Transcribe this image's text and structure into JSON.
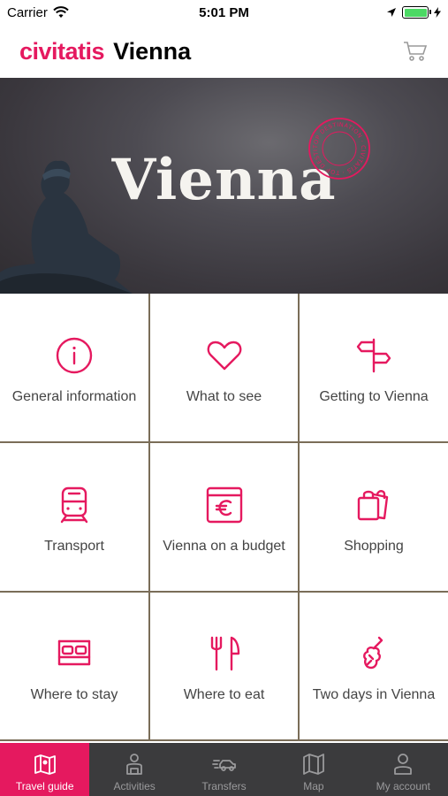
{
  "status_bar": {
    "carrier": "Carrier",
    "time": "5:01 PM",
    "wifi_icon": "wifi-icon",
    "location_icon": "location-arrow-icon",
    "battery_level": 1.0,
    "charging_icon": "bolt-icon"
  },
  "header": {
    "brand": "civitatis",
    "city": "Vienna",
    "cart_icon": "cart-icon",
    "brand_color": "#e5195f"
  },
  "hero": {
    "title": "Vienna",
    "stamp_text": "TOP DESTINATION · CIVITATIS · "
  },
  "grid": [
    {
      "label": "General information",
      "icon": "info-icon"
    },
    {
      "label": "What to see",
      "icon": "heart-icon"
    },
    {
      "label": "Getting to Vienna",
      "icon": "signpost-icon"
    },
    {
      "label": "Transport",
      "icon": "train-icon"
    },
    {
      "label": "Vienna on a budget",
      "icon": "euro-wallet-icon"
    },
    {
      "label": "Shopping",
      "icon": "shopping-bag-icon"
    },
    {
      "label": "Where to stay",
      "icon": "bed-icon"
    },
    {
      "label": "Where to eat",
      "icon": "fork-knife-icon"
    },
    {
      "label": "Two days in Vienna",
      "icon": "violin-icon"
    }
  ],
  "tabs": [
    {
      "label": "Travel guide",
      "icon": "map-icon",
      "active": true
    },
    {
      "label": "Activities",
      "icon": "activities-icon",
      "active": false
    },
    {
      "label": "Transfers",
      "icon": "car-icon",
      "active": false
    },
    {
      "label": "Map",
      "icon": "folded-map-icon",
      "active": false
    },
    {
      "label": "My account",
      "icon": "user-icon",
      "active": false
    }
  ],
  "colors": {
    "accent": "#e5195f",
    "tab_bar": "#3b3b3d"
  }
}
